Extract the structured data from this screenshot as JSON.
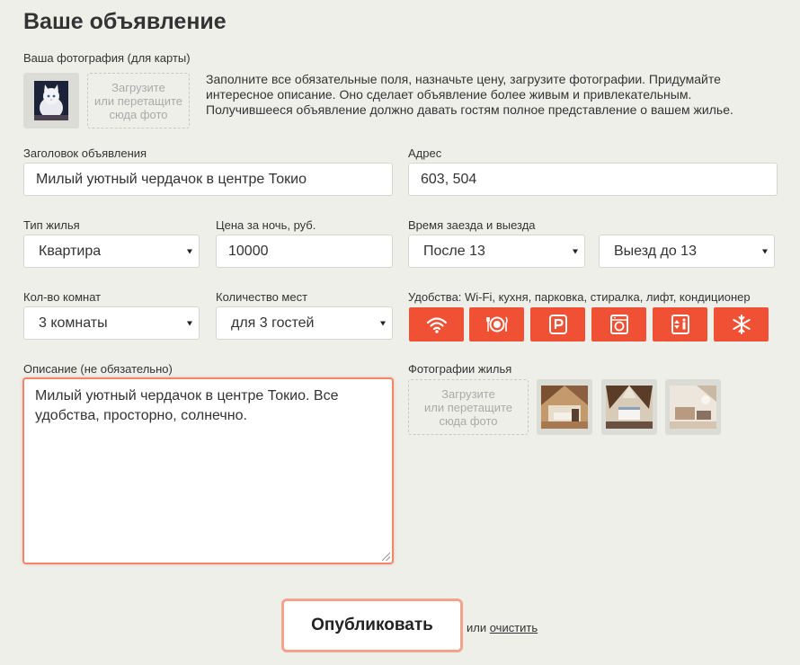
{
  "page": {
    "title": "Ваше объявление"
  },
  "photo": {
    "label": "Ваша фотография (для карты)",
    "dropzone_line1": "Загрузите",
    "dropzone_line2": "или перетащите",
    "dropzone_line3": "сюда фото",
    "intro_text": "Заполните все обязательные поля, назначьте цену, загрузите фотографии. Придумайте интересное описание. Оно сделает объявление более живым и привлекательным. Получившееся объявление должно давать гостям полное представление о вашем жилье."
  },
  "fields": {
    "title_label": "Заголовок объявления",
    "title_value": "Милый уютный чердачок в центре Токио",
    "address_label": "Адрес",
    "address_value": "603, 504",
    "type_label": "Тип жилья",
    "type_value": "Квартира",
    "price_label": "Цена за ночь, руб.",
    "price_value": "10000",
    "checkin_label": "Время заезда и выезда",
    "checkin_value": "После 13",
    "checkout_value": "Выезд до 13",
    "rooms_label": "Кол-во комнат",
    "rooms_value": "3 комнаты",
    "guests_label": "Количество мест",
    "guests_value": "для 3 гостей",
    "amenities_label": "Удобства: Wi-Fi, кухня, парковка, стиралка, лифт, кондиционер",
    "description_label": "Описание (не обязательно)",
    "description_value": "Милый уютный чердачок в центре Токио. Все удобства, просторно, солнечно."
  },
  "amenities": [
    {
      "icon": "wifi-icon"
    },
    {
      "icon": "kitchen-icon"
    },
    {
      "icon": "parking-icon"
    },
    {
      "icon": "washer-icon"
    },
    {
      "icon": "elevator-icon"
    },
    {
      "icon": "conditioner-icon"
    }
  ],
  "housing_photos": {
    "label": "Фотографии жилья",
    "dropzone_line1": "Загрузите",
    "dropzone_line2": "или перетащите",
    "dropzone_line3": "сюда фото"
  },
  "actions": {
    "publish_label": "Опубликовать",
    "or_text": "или",
    "clear_label": "очистить"
  },
  "colors": {
    "accent": "#f05033",
    "background": "#efefea",
    "focus_border": "#f0876a",
    "publish_border": "#f2a48d"
  }
}
